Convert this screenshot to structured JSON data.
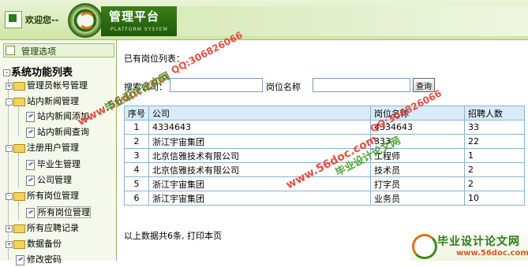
{
  "header": {
    "welcome": "欢迎您--",
    "app_title": "管理平台",
    "app_subtitle": "PLATFORM SYSYEM"
  },
  "sidebar": {
    "tab_label": "管理选项",
    "title": "系统功能列表",
    "items": [
      {
        "label": "管理员帐号管理",
        "expander": "+"
      },
      {
        "label": "站内新闻管理",
        "expander": "-"
      },
      {
        "label": "站内新闻添加"
      },
      {
        "label": "站内新闻查询"
      },
      {
        "label": "注册用户管理",
        "expander": "-"
      },
      {
        "label": "毕业生管理"
      },
      {
        "label": "公司管理"
      },
      {
        "label": "所有岗位管理",
        "expander": "-"
      },
      {
        "label": "所有岗位管理"
      },
      {
        "label": "所有应聘记录",
        "expander": "+"
      },
      {
        "label": "数据备份",
        "expander": "+"
      },
      {
        "label": "修改密码"
      }
    ]
  },
  "main": {
    "list_title": "已有岗位列表：",
    "search": {
      "company_label": "搜索公司：",
      "company_value": "",
      "position_label": "岗位名称",
      "position_value": "",
      "button_label": "查询"
    },
    "table": {
      "columns": [
        "序号",
        "公司",
        "岗位名称",
        "招聘人数"
      ],
      "rows": [
        [
          "1",
          "4334643",
          "4334643",
          "33"
        ],
        [
          "2",
          "浙江宇宙集团",
          "333",
          "22"
        ],
        [
          "3",
          "北京信雅技术有限公司",
          "工程师",
          "1"
        ],
        [
          "4",
          "北京信雅技术有限公司",
          "技术员",
          "2"
        ],
        [
          "5",
          "浙江宇宙集团",
          "打字员",
          "2"
        ],
        [
          "6",
          "浙江宇宙集团",
          "业务员",
          "10"
        ]
      ]
    },
    "footer": "以上数据共6条, 打印本页"
  },
  "watermarks": {
    "site_cn": "毕业设计论文网",
    "site_url": "www.56doc.com",
    "qq": "QQ:306826066",
    "corner_title": "毕业设计论文网",
    "corner_url": "www.56doc.com"
  },
  "colors": {
    "header_green": "#2f6e14",
    "sidebar_bg": "#f4f9ec",
    "table_header_bg": "#d8ecf8",
    "table_border": "#8ab2d2",
    "watermark_red": "#e53b2e",
    "watermark_green": "#3e9a1e"
  }
}
